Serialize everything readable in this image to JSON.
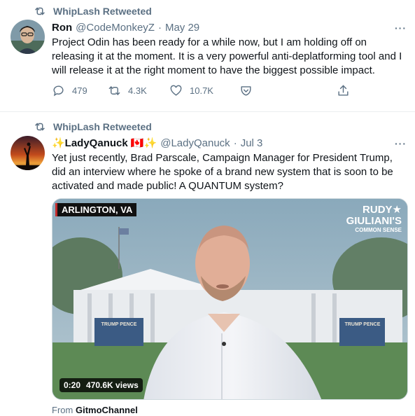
{
  "tweets": [
    {
      "retweet_label": "WhipLash Retweeted",
      "name": "Ron",
      "handle": "@CodeMonkeyZ",
      "date": "May 29",
      "text": "Project Odin has been ready for a while now, but I am holding off on releasing it at the moment. It is a very powerful anti-deplatforming tool and I will release it at the right moment to have the biggest possible impact.",
      "replies": "479",
      "retweets": "4.3K",
      "likes": "10.7K"
    },
    {
      "retweet_label": "WhipLash Retweeted",
      "name": "✨LadyQanuck 🇨🇦✨",
      "handle": "@LadyQanuck",
      "date": "Jul 3",
      "text": "Yet just recently, Brad Parscale, Campaign Manager for President Trump, did an interview where he spoke of a brand new system that is soon to be activated and made public! A QUANTUM system?",
      "video": {
        "location_tag": "ARLINGTON, VA",
        "logo_line1": "RUDY★",
        "logo_line2": "GIULIANI'S",
        "logo_line3": "COMMON SENSE",
        "podium_sign": "TRUMP PENCE",
        "duration": "0:20",
        "views": "470.6K views"
      },
      "from_prefix": "From",
      "from_source": "GitmoChannel"
    }
  ],
  "more_glyph": "···",
  "colors": {
    "secondary_text": "#5b7083",
    "primary_text": "#0f1419",
    "divider": "#ebeef0"
  }
}
